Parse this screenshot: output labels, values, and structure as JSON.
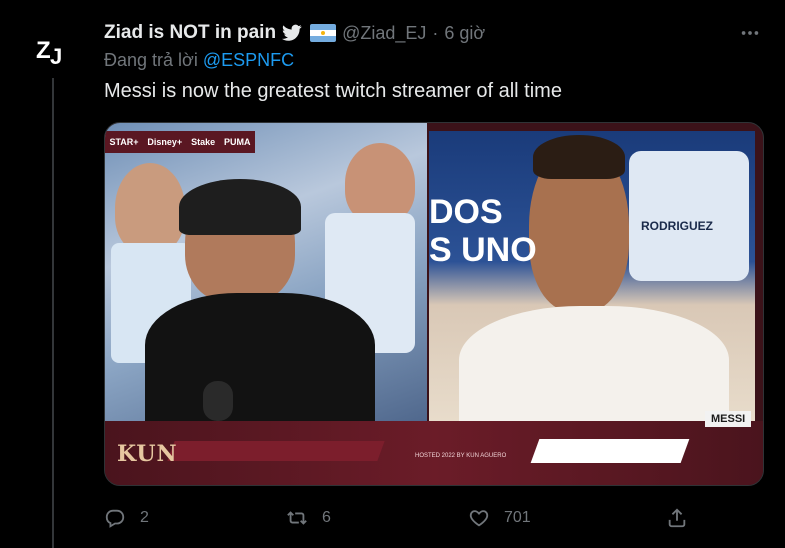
{
  "author": {
    "display_name": "Ziad is NOT in pain",
    "handle": "@Ziad_EJ",
    "separator": "·",
    "time": "6 giờ",
    "avatar_text": "ZJ"
  },
  "reply": {
    "prefix": "Đang trả lời ",
    "mention": "@ESPNFC"
  },
  "tweet": {
    "text": "Messi is now the greatest twitch streamer of all time"
  },
  "media": {
    "sponsors": [
      "STAR+",
      "Disney+",
      "Stake",
      "PUMA"
    ],
    "right_overlay": "DOS\nS UNO",
    "jersey_name": "RODRIGUEZ",
    "logo": "KUN",
    "hosted": "HOSTED 2022 BY KUN AGUERO",
    "name_tag": "MESSI"
  },
  "actions": {
    "reply_count": "2",
    "retweet_count": "6",
    "like_count": "701"
  },
  "colors": {
    "background": "#000000",
    "text": "#e7e9ea",
    "muted": "#71767b",
    "link": "#1d9bf0"
  },
  "icons": [
    "ellipsis-icon",
    "verified-bird-icon",
    "argentina-flag-icon",
    "reply-icon",
    "retweet-icon",
    "like-icon",
    "share-icon"
  ]
}
